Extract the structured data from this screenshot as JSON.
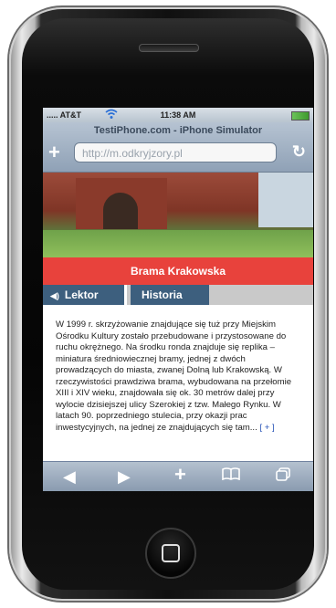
{
  "status_bar": {
    "carrier": "..... AT&T",
    "time": "11:38 AM"
  },
  "browser": {
    "title": "TestiPhone.com - iPhone Simulator",
    "url": "http://m.odkryjzory.pl"
  },
  "page": {
    "banner_title": "Brama Krakowska",
    "tabs": [
      {
        "label": "Lektor"
      },
      {
        "label": "Historia"
      }
    ],
    "body_text": "W 1999 r. skrzyżowanie znajdujące się tuż przy Miejskim Ośrodku Kultury zostało przebudowane i przystosowane do ruchu okrężnego. Na środku ronda znajduje się replika – miniatura średniowiecznej bramy, jednej z dwóch prowadzących do miasta, zwanej Dolną lub Krakowską. W rzeczywistości prawdziwa brama, wybudowana na przełomie XIII i XIV wieku, znajdowała się ok. 30 metrów dalej przy wylocie dzisiejszej ulicy Szerokiej z tzw. Małego Rynku. W latach 90. poprzedniego stulecia, przy okazji prac inwestycyjnych, na jednej ze znajdujących się tam...",
    "more_link": "[ + ]"
  },
  "toolbar": {
    "icons": [
      "back-icon",
      "forward-icon",
      "add-bookmark-icon",
      "bookmarks-icon",
      "pages-icon"
    ]
  },
  "colors": {
    "banner": "#e8423c",
    "tab": "#3d5f7e",
    "link": "#2a55b8"
  }
}
